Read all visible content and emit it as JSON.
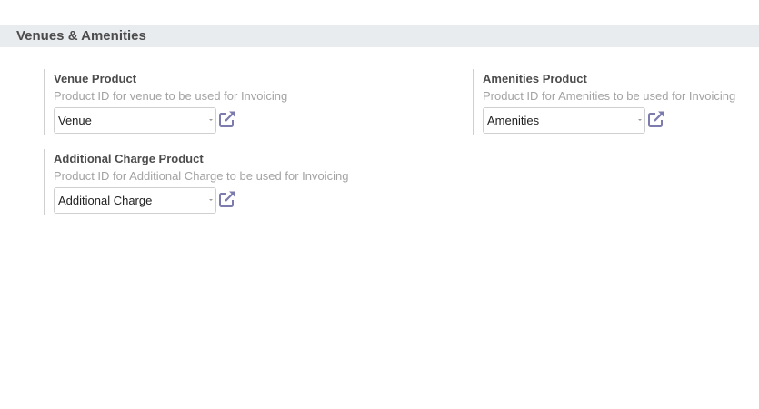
{
  "section": {
    "title": "Venues & Amenities"
  },
  "settings": [
    {
      "title": "Venue Product",
      "help": "Product ID for venue to be used for Invoicing",
      "value": "Venue",
      "link_icon": "external-link-icon"
    },
    {
      "title": "Amenities Product",
      "help": "Product ID for Amenities to be used for Invoicing",
      "value": "Amenities",
      "link_icon": "external-link-icon"
    },
    {
      "title": "Additional Charge Product",
      "help": "Product ID for Additional Charge to be used for Invoicing",
      "value": "Additional Charge",
      "link_icon": "external-link-icon"
    }
  ],
  "colors": {
    "icon": "#7c7bad",
    "section_bg": "#e9ecef",
    "help_text": "#a3a3a3"
  }
}
